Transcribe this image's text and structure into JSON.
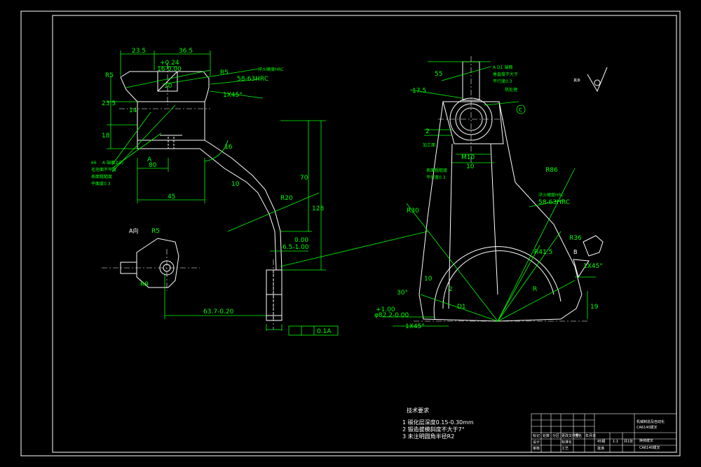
{
  "drawing": {
    "colors": {
      "outline": "#ffffff",
      "dimension": "#00ff00",
      "background": "#000000",
      "accent": "#ff0000"
    },
    "view_front": {
      "dims": {
        "d23_5": "23.5",
        "d36_5": "36.5",
        "tol_plus": "+0.24",
        "tol_minus": "16-0.00",
        "d10": "10",
        "r5a": "R5",
        "r5b": "R5",
        "d14": "14",
        "d23_5v": "23.5",
        "d18": "18",
        "d45deg": "1X45°",
        "d16": "16",
        "d80": "80",
        "d45": "45",
        "d70": "70",
        "d128": "128",
        "d0_00": "0.00",
        "d6_5": "6.5-1.00",
        "d63_7": "63.7-0.20",
        "r20": "R20",
        "d10b": "10",
        "flat": "0.1A"
      },
      "section_label": "A",
      "note_hrc": "淬火硬度HRC",
      "note_hrc_value": "58-63HRC",
      "note_a": "A 端面上的",
      "note_a2": "毛坯面不平度",
      "note_a3": "表面粗糙度",
      "note_a4": "平面度0.3",
      "note_left_a": "66",
      "view_a_label": "A向",
      "view_a_r": "R5",
      "view_a_r2": "R9"
    },
    "view_side": {
      "dims": {
        "s55": "55",
        "s17_5": "17.5",
        "s2": "2",
        "m10": "M10",
        "s10": "10",
        "r86": "R86",
        "r30": "R30",
        "r36": "R36",
        "r41": "R41.5",
        "r": "R",
        "d1": "D1",
        "d82": "φ82.2-0.00",
        "d82p": "+1.00",
        "s1x45": "1X45°",
        "s1x45b": "1X45°",
        "s30": "30°",
        "s10b": "10",
        "s2b": "2",
        "b": "B",
        "s19": "19",
        "c": "c"
      },
      "note_d1": "A D1 端面",
      "note_d1b": "垂直度不大于",
      "note_d1c": "平行度0.3",
      "note_hrc": "淬火硬度HRC",
      "note_hrc_value": "58-63HRC",
      "note_surface": "其余",
      "note_left": "加工面",
      "note_left2": "表面粗糙度",
      "note_left3": "平行度0.3",
      "note_spot": "热处理"
    },
    "tech_req": {
      "title": "技术要求",
      "items": [
        "1  碳化层深度0.15-0.30mm",
        "2  锻造拔模斜度不大于7°",
        "3  未注明圆角半径R2"
      ]
    },
    "title_block": {
      "part_name": "换挡拨叉",
      "material": "45钢",
      "scale": "1:1",
      "sheet": "共1张",
      "drawing_no": "CA6140拨叉",
      "school": "机械制造及自动化",
      "designer": "设计",
      "checker": "审核",
      "standard": "标准化",
      "process": "工艺",
      "approve": "批准",
      "headers": [
        "标记",
        "处数",
        "分区",
        "更改文件号",
        "签名",
        "年月日"
      ]
    }
  }
}
